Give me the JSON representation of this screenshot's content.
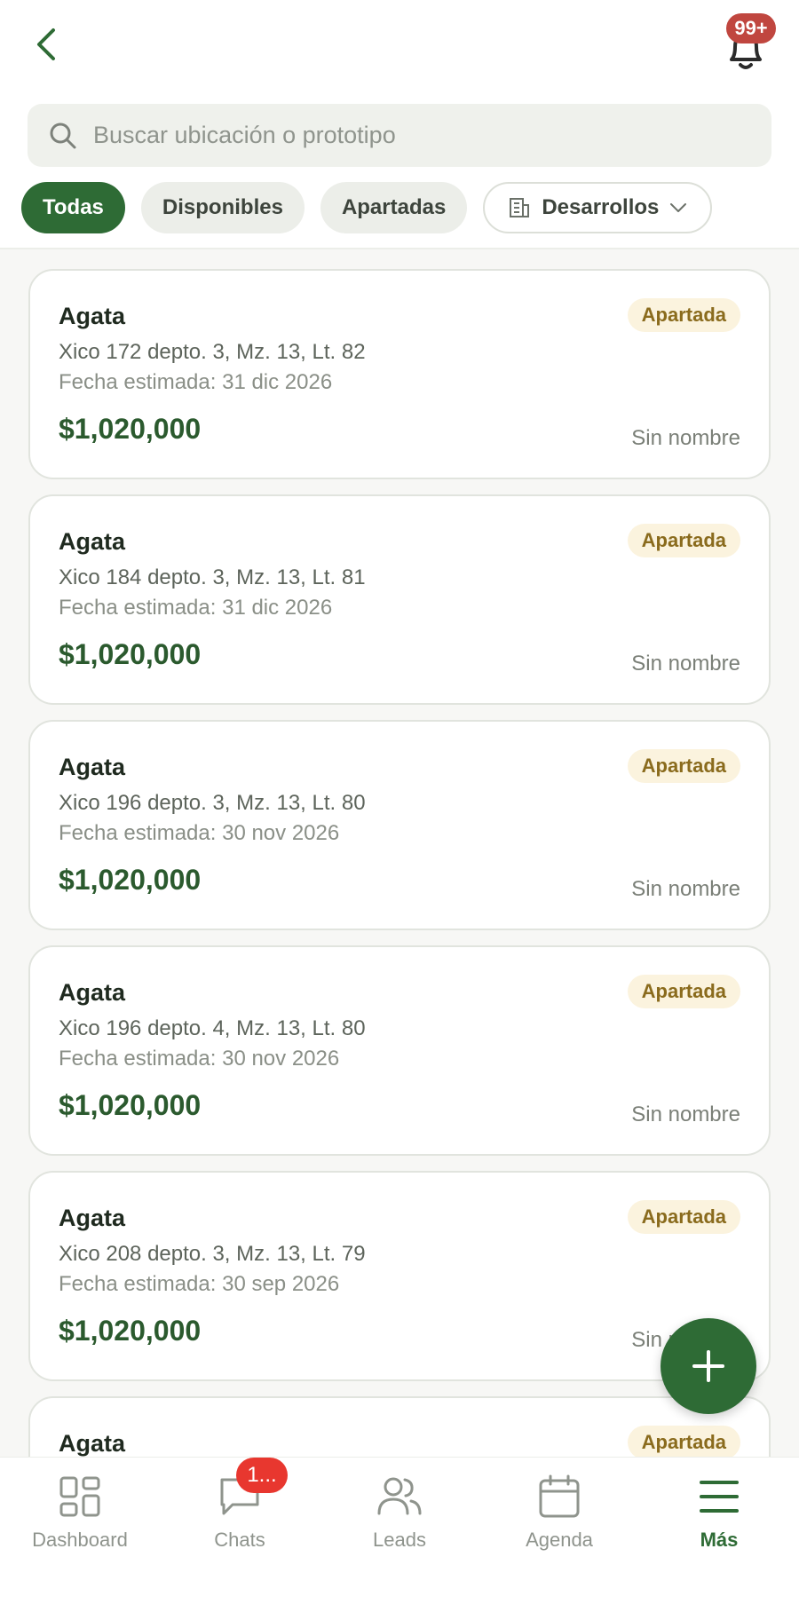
{
  "header": {
    "back_icon": "chevron-left-icon",
    "bell_icon": "bell-icon",
    "notifications_badge": "99+"
  },
  "search": {
    "placeholder": "Buscar ubicación o prototipo",
    "value": ""
  },
  "filters": {
    "all": "Todas",
    "available": "Disponibles",
    "reserved": "Apartadas",
    "developments": "Desarrollos"
  },
  "units": [
    {
      "name": "Agata",
      "address": "Xico 172 depto. 3, Mz. 13, Lt. 82",
      "date": "Fecha estimada: 31 dic 2026",
      "price": "$1,020,000",
      "status": "Apartada",
      "client": "Sin nombre"
    },
    {
      "name": "Agata",
      "address": "Xico 184 depto. 3, Mz. 13, Lt. 81",
      "date": "Fecha estimada: 31 dic 2026",
      "price": "$1,020,000",
      "status": "Apartada",
      "client": "Sin nombre"
    },
    {
      "name": "Agata",
      "address": "Xico 196 depto. 3, Mz. 13, Lt. 80",
      "date": "Fecha estimada: 30 nov 2026",
      "price": "$1,020,000",
      "status": "Apartada",
      "client": "Sin nombre"
    },
    {
      "name": "Agata",
      "address": "Xico 196 depto. 4, Mz. 13, Lt. 80",
      "date": "Fecha estimada: 30 nov 2026",
      "price": "$1,020,000",
      "status": "Apartada",
      "client": "Sin nombre"
    },
    {
      "name": "Agata",
      "address": "Xico 208 depto. 3, Mz. 13, Lt. 79",
      "date": "Fecha estimada: 30 sep 2026",
      "price": "$1,020,000",
      "status": "Apartada",
      "client": "Sin nombre"
    },
    {
      "name": "Agata",
      "status": "Apartada"
    }
  ],
  "tabbar": {
    "dashboard": "Dashboard",
    "chats": "Chats",
    "chats_badge": "1...",
    "leads": "Leads",
    "agenda": "Agenda",
    "more": "Más"
  },
  "colors": {
    "primary": "#2e6b35",
    "badge_bg": "#fbf3de",
    "badge_text": "#8a6b1d",
    "alert": "#c0463f"
  }
}
